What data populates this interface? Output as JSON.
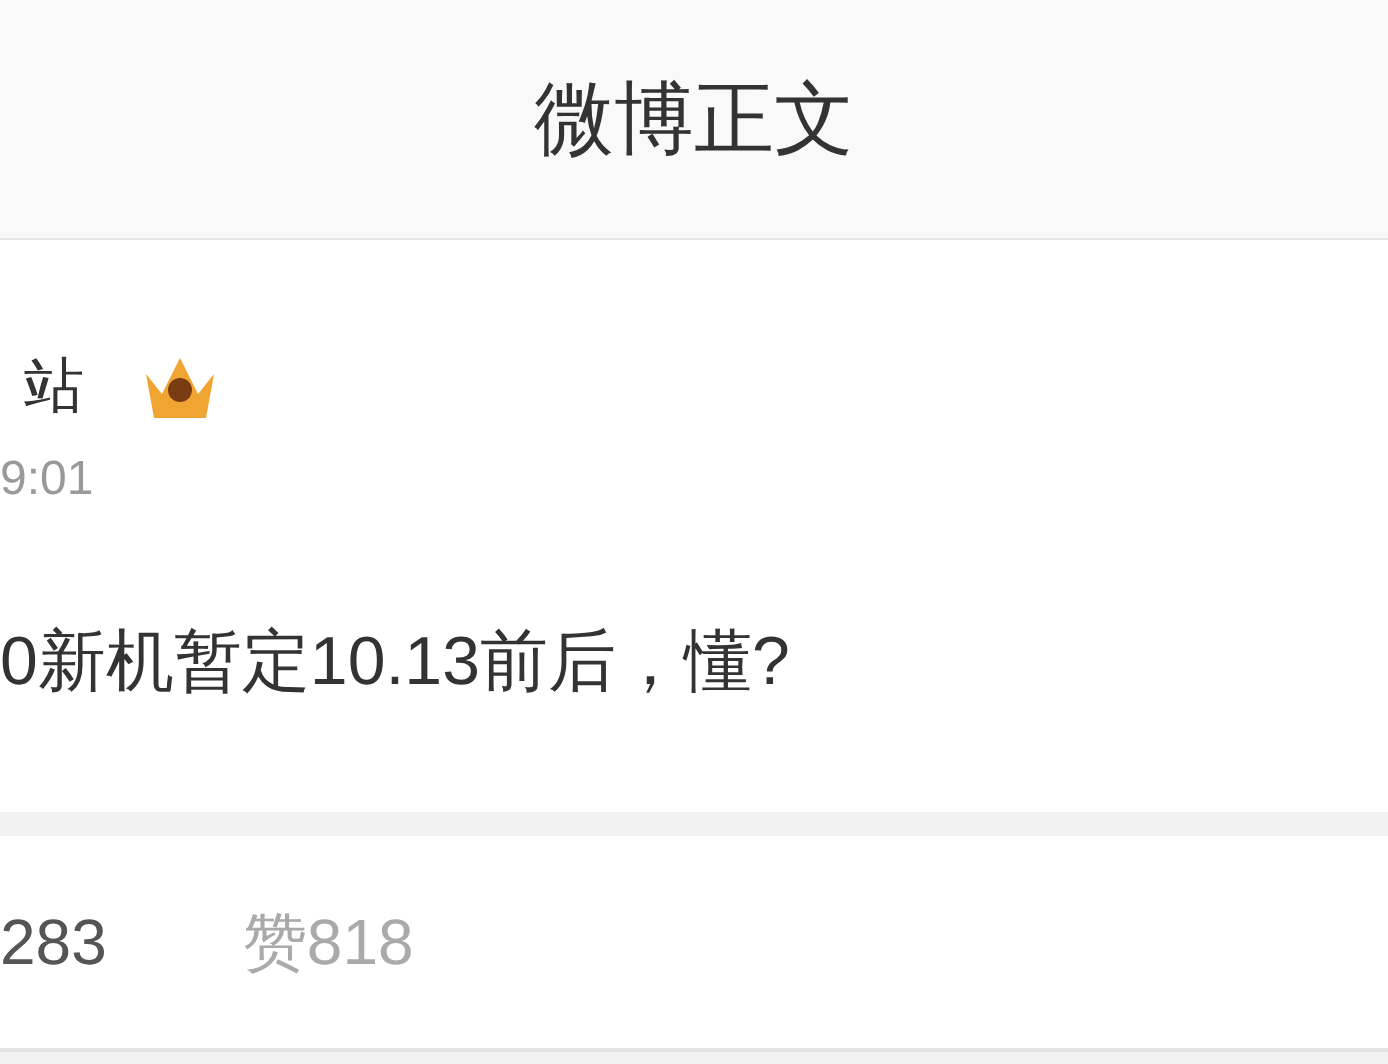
{
  "header": {
    "title": "微博正文"
  },
  "post": {
    "author": "站",
    "time": "9:01",
    "text": "0新机暂定10.13前后，懂?"
  },
  "tabs": [
    {
      "label": "283",
      "selected": true
    },
    {
      "label": "赞818",
      "selected": false
    }
  ]
}
